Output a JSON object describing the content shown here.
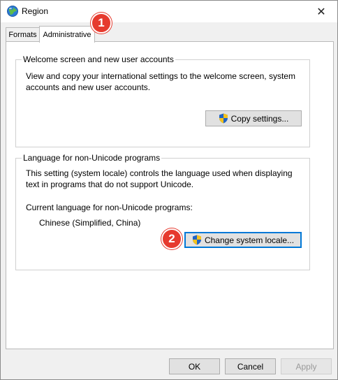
{
  "window": {
    "title": "Region",
    "close_glyph": "✕"
  },
  "tabs": [
    {
      "label": "Formats"
    },
    {
      "label": "Administrative"
    }
  ],
  "welcome_group": {
    "legend": "Welcome screen and new user accounts",
    "description_line1": "View and copy your international settings to the welcome screen, system",
    "description_line2": "accounts and new user accounts.",
    "copy_button": "Copy settings..."
  },
  "locale_group": {
    "legend": "Language for non-Unicode programs",
    "description_line1": "This setting (system locale) controls the language used when displaying",
    "description_line2": "text in programs that do not support Unicode.",
    "current_label": "Current language for non-Unicode programs:",
    "current_value": "Chinese (Simplified, China)",
    "change_button": "Change system locale..."
  },
  "footer": {
    "ok": "OK",
    "cancel": "Cancel",
    "apply": "Apply"
  },
  "annotations": [
    {
      "label": "1"
    },
    {
      "label": "2"
    }
  ],
  "colors": {
    "badge": "#e63a2e",
    "focus": "#0078d7",
    "shield_blue": "#1f63c6",
    "shield_yellow": "#f4c21b"
  }
}
